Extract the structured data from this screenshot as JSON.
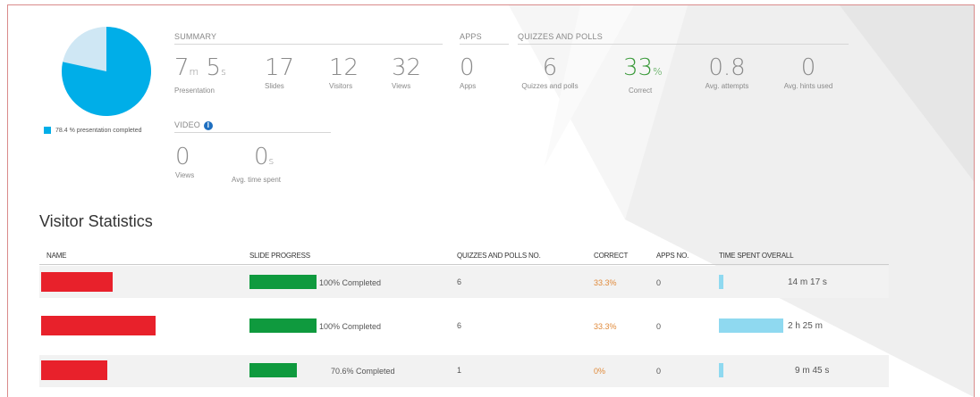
{
  "pie": {
    "completed_pct": 78.4,
    "legend_label": "78.4 % presentation completed",
    "colors": {
      "completed": "#00aee8",
      "remaining": "#cfe7f4"
    }
  },
  "summary": {
    "section_label": "SUMMARY",
    "presentation": {
      "min": "7",
      "min_unit": "m",
      "sec": "5",
      "sec_unit": "s",
      "label": "Presentation"
    },
    "slides": {
      "value": "17",
      "label": "Slides"
    },
    "visitors": {
      "value": "12",
      "label": "Visitors"
    },
    "views": {
      "value": "32",
      "label": "Views"
    }
  },
  "apps": {
    "section_label": "APPS",
    "apps": {
      "value": "0",
      "label": "Apps"
    }
  },
  "quizzes": {
    "section_label": "QUIZZES AND POLLS",
    "count": {
      "value": "6",
      "label": "Quizzes and polls"
    },
    "correct": {
      "value": "33",
      "unit": "%",
      "label": "Correct"
    },
    "attempts": {
      "value": "0.8",
      "label": "Avg. attempts"
    },
    "hints": {
      "value": "0",
      "label": "Avg. hints used"
    }
  },
  "video": {
    "section_label": "VIDEO",
    "views": {
      "value": "0",
      "label": "Views"
    },
    "time": {
      "value": "0",
      "unit": "s",
      "label": "Avg. time spent"
    }
  },
  "visitor_stats": {
    "title": "Visitor Statistics",
    "columns": {
      "name": "NAME",
      "slide_progress": "SLIDE PROGRESS",
      "quizzes": "QUIZZES AND POLLS NO.",
      "correct": "CORRECT",
      "apps": "APPS NO.",
      "time": "TIME SPENT OVERALL"
    },
    "rows": [
      {
        "progress_pct": 100,
        "progress_text": "100% Completed",
        "quizzes": "6",
        "correct": "33.3%",
        "apps": "0",
        "time": "14 m 17 s",
        "time_frac": 0.06
      },
      {
        "progress_pct": 100,
        "progress_text": "100% Completed",
        "quizzes": "6",
        "correct": "33.3%",
        "apps": "0",
        "time": "2 h 25 m",
        "time_frac": 1.0
      },
      {
        "progress_pct": 70.6,
        "progress_text": "70.6% Completed",
        "quizzes": "1",
        "correct": "0%",
        "apps": "0",
        "time": "9 m 45 s",
        "time_frac": 0.05
      }
    ]
  }
}
